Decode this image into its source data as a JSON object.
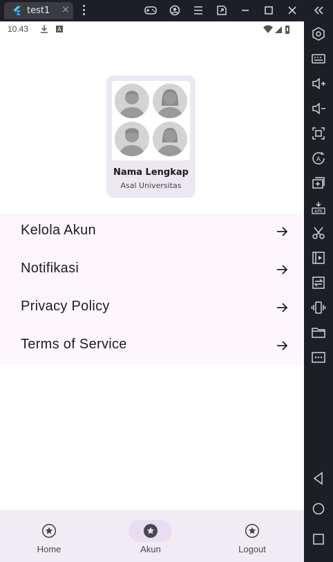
{
  "window": {
    "tab_title": "test1",
    "tab_close": "×"
  },
  "toolbar_icons": [
    "gamepad-icon",
    "account-icon",
    "menu-icon",
    "expand-icon",
    "minimize-icon",
    "maximize-icon",
    "close-icon",
    "collapse-sidebar-icon"
  ],
  "sidebar_icons": [
    "settings-icon",
    "keyboard-icon",
    "volume-up-icon",
    "volume-down-icon",
    "screenshot-icon",
    "rotate-icon",
    "add-window-icon",
    "apk-icon",
    "cut-icon",
    "media-icon",
    "sync-icon",
    "shake-icon",
    "folder-icon",
    "more-icon",
    "back-icon",
    "home-icon",
    "recents-icon"
  ],
  "status_bar": {
    "time": "10.43"
  },
  "profile": {
    "name": "Nama Lengkap",
    "university": "Asal Universitas"
  },
  "menu": {
    "items": [
      {
        "label": "Kelola Akun"
      },
      {
        "label": "Notifikasi"
      },
      {
        "label": "Privacy Policy"
      },
      {
        "label": "Terms of Service"
      }
    ]
  },
  "bottom_nav": {
    "items": [
      {
        "label": "Home",
        "active": false
      },
      {
        "label": "Akun",
        "active": true
      },
      {
        "label": "Logout",
        "active": false
      }
    ]
  },
  "colors": {
    "accent": "#e9ddf3",
    "menu_bg": "#fdf7fd",
    "card_bg": "#ece7f1",
    "nav_bg": "#f1ecf4"
  }
}
